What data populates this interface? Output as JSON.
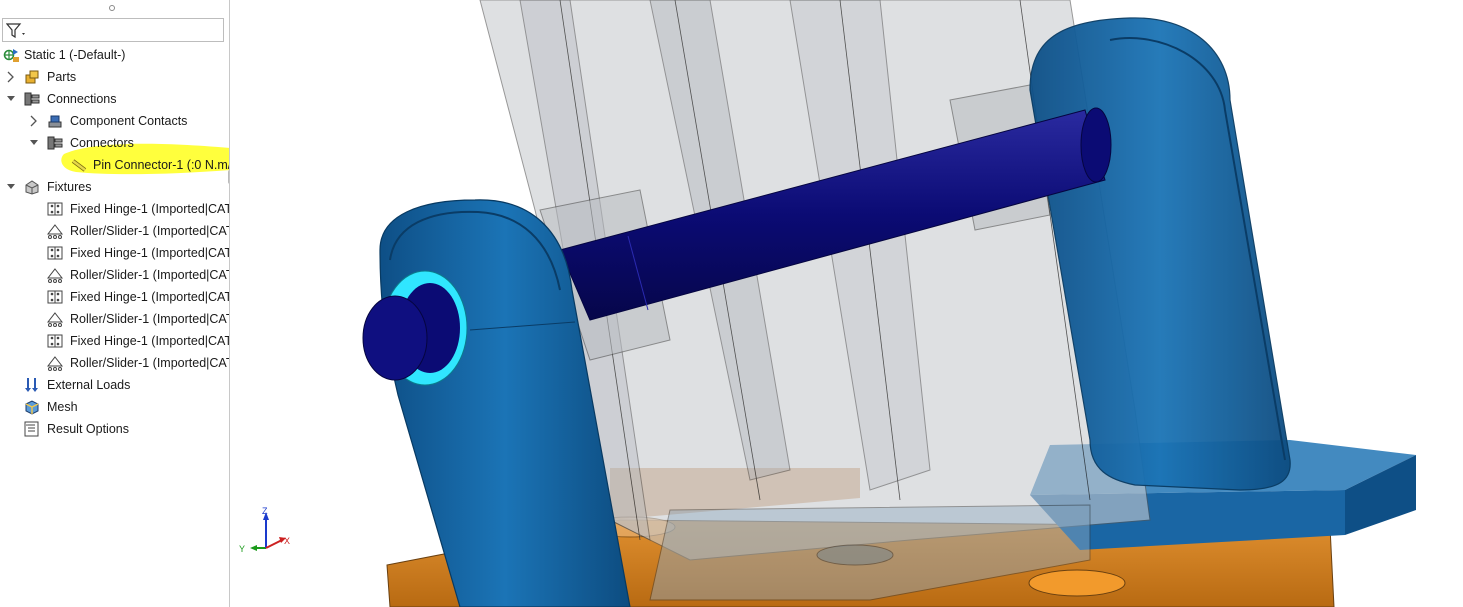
{
  "tree": {
    "root": {
      "label": "Static 1 (-Default-)",
      "icon": "study-icon"
    },
    "items": [
      {
        "id": "parts",
        "label": "Parts",
        "icon": "parts-icon"
      },
      {
        "id": "connections",
        "label": "Connections",
        "icon": "connections-icon"
      },
      {
        "id": "component-contacts",
        "label": "Component Contacts",
        "icon": "component-contacts-icon"
      },
      {
        "id": "connectors",
        "label": "Connectors",
        "icon": "connectors-icon"
      },
      {
        "id": "pin-connector",
        "label": "Pin Connector-1 (:0 N.m/",
        "icon": "pin-connector-icon"
      },
      {
        "id": "fixtures",
        "label": "Fixtures",
        "icon": "fixtures-icon"
      },
      {
        "id": "fixture-1",
        "label": "Fixed Hinge-1 (Imported|CATI",
        "icon": "fixed-hinge-icon"
      },
      {
        "id": "fixture-2",
        "label": "Roller/Slider-1 (Imported|CAT",
        "icon": "roller-slider-icon"
      },
      {
        "id": "fixture-3",
        "label": "Fixed Hinge-1 (Imported|CATI",
        "icon": "fixed-hinge-icon"
      },
      {
        "id": "fixture-4",
        "label": "Roller/Slider-1 (Imported|CAT",
        "icon": "roller-slider-icon"
      },
      {
        "id": "fixture-5",
        "label": "Fixed Hinge-1 (Imported|CATI",
        "icon": "fixed-hinge-icon"
      },
      {
        "id": "fixture-6",
        "label": "Roller/Slider-1 (Imported|CAT",
        "icon": "roller-slider-icon"
      },
      {
        "id": "fixture-7",
        "label": "Fixed Hinge-1 (Imported|CATI",
        "icon": "fixed-hinge-icon"
      },
      {
        "id": "fixture-8",
        "label": "Roller/Slider-1 (Imported|CAT",
        "icon": "roller-slider-icon"
      },
      {
        "id": "external-loads",
        "label": "External Loads",
        "icon": "external-loads-icon"
      },
      {
        "id": "mesh",
        "label": "Mesh",
        "icon": "mesh-icon"
      },
      {
        "id": "result-options",
        "label": "Result Options",
        "icon": "result-options-icon"
      }
    ]
  },
  "filter": {
    "icon": "filter-icon"
  },
  "triad": {
    "x": "X",
    "y": "Y",
    "z": "Z"
  },
  "colors": {
    "highlight": "#ffff33",
    "bracket_blue": "#1467a6",
    "pin_navy": "#0b0b74",
    "selection_cyan": "#30e6ff",
    "base_orange": "#d4841f",
    "transparent_grey": "#9aa0a6"
  }
}
